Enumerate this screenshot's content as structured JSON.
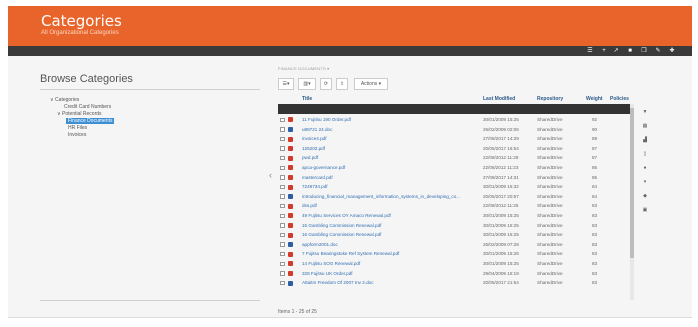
{
  "header": {
    "title": "Categories",
    "subtitle": "All Organizational Categories"
  },
  "toolbar": {
    "icons": [
      "list-icon",
      "plus-icon",
      "share-icon",
      "lock-icon",
      "copy-icon",
      "edit-icon",
      "add-icon"
    ]
  },
  "sidebar": {
    "title": "Browse Categories",
    "tree": [
      {
        "label": "∨ Categories",
        "level": 0
      },
      {
        "label": "Credit Card Numbers",
        "level": 1
      },
      {
        "label": "∨ Potential Records",
        "level": 1
      },
      {
        "label": "Finance Documents",
        "level": 2,
        "selected": true
      },
      {
        "label": "HR Files",
        "level": 2
      },
      {
        "label": "Invoices",
        "level": 2
      }
    ]
  },
  "breadcrumb": "FINANCE DOCUMENTS ▾",
  "docbar": {
    "actions_label": "Actions ▾"
  },
  "table": {
    "columns": {
      "title": "Title",
      "modified": "Last Modified",
      "repository": "Repository",
      "weight": "Weight",
      "policies": "Policies"
    },
    "rows": [
      {
        "title": "11 Fujitsu 190 Order.pdf",
        "date": "30/01/2009 15:25",
        "repo": "SharedDrive",
        "weight": "92",
        "type": "pdf"
      },
      {
        "title": "u89721 24.doc",
        "date": "26/02/2009 02:06",
        "repo": "SharedDrive",
        "weight": "90",
        "type": "doc"
      },
      {
        "title": "invoice4.pdf",
        "date": "27/08/2017 14:29",
        "repo": "SharedDrive",
        "weight": "89",
        "type": "pdf"
      },
      {
        "title": "125202.pdf",
        "date": "20/05/2017 16:54",
        "repo": "SharedDrive",
        "weight": "87",
        "type": "pdf"
      },
      {
        "title": "pwd.pdf",
        "date": "22/08/2012 11:28",
        "repo": "SharedDrive",
        "weight": "87",
        "type": "pdf"
      },
      {
        "title": "apca-governance.pdf",
        "date": "22/08/2012 11:23",
        "repo": "SharedDrive",
        "weight": "86",
        "type": "pdf"
      },
      {
        "title": "mastercard.pdf",
        "date": "27/08/2017 14:31",
        "repo": "SharedDrive",
        "weight": "85",
        "type": "pdf"
      },
      {
        "title": "7249734.pdf",
        "date": "30/01/2009 15:32",
        "repo": "SharedDrive",
        "weight": "84",
        "type": "pdf"
      },
      {
        "title": "introducing_financial_management_information_systems_in_developing_co...",
        "date": "20/05/2017 20:57",
        "repo": "SharedDrive",
        "weight": "84",
        "type": "doc"
      },
      {
        "title": "dss.pdf",
        "date": "22/08/2012 11:25",
        "repo": "SharedDrive",
        "weight": "83",
        "type": "pdf"
      },
      {
        "title": "49 Fujitsu Services OY Amaco Renewal.pdf",
        "date": "30/01/2009 15:25",
        "repo": "SharedDrive",
        "weight": "83",
        "type": "pdf"
      },
      {
        "title": "15 Gambling Commission Renewal.pdf",
        "date": "30/01/2009 15:25",
        "repo": "SharedDrive",
        "weight": "83",
        "type": "pdf"
      },
      {
        "title": "16 Gambling Commission Renewal.pdf",
        "date": "30/01/2009 15:25",
        "repo": "SharedDrive",
        "weight": "83",
        "type": "pdf"
      },
      {
        "title": "appform2001.doc",
        "date": "26/02/2009 07:28",
        "repo": "SharedDrive",
        "weight": "83",
        "type": "doc"
      },
      {
        "title": "7 Fujitsu Bearingstoke Ref System Renewal.pdf",
        "date": "30/01/2009 15:26",
        "repo": "SharedDrive",
        "weight": "83",
        "type": "pdf"
      },
      {
        "title": "14 Fujitsu SOG Renewal.pdf",
        "date": "30/01/2009 15:25",
        "repo": "SharedDrive",
        "weight": "83",
        "type": "pdf"
      },
      {
        "title": "328 Fujitsu UK Order.pdf",
        "date": "29/04/2009 15:19",
        "repo": "SharedDrive",
        "weight": "83",
        "type": "pdf"
      },
      {
        "title": "Attaitm Freedom Of 2007 Inv 2.doc",
        "date": "20/05/2017 21:54",
        "repo": "SharedDrive",
        "weight": "83",
        "type": "doc"
      }
    ]
  },
  "pager": "Items 1 - 25 of 25"
}
